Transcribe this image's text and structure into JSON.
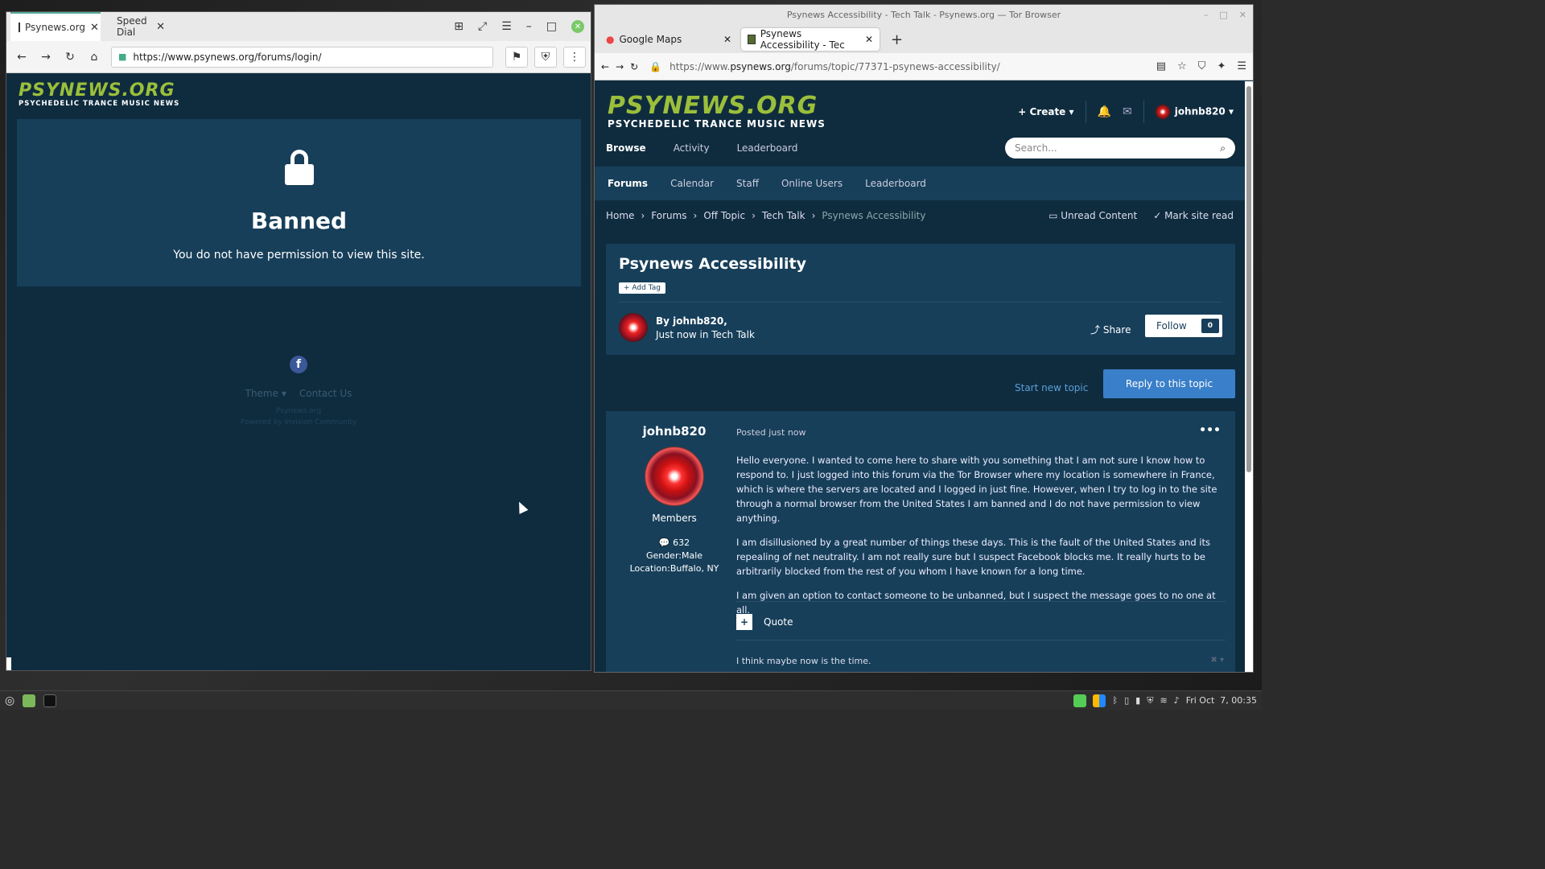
{
  "left_window": {
    "tabs": [
      {
        "label": "Psynews.org",
        "close": "✕"
      },
      {
        "label": "Speed Dial",
        "close": "✕"
      }
    ],
    "url": "https://www.psynews.org/forums/login/",
    "logo": {
      "line1": "PSYNEWS.ORG",
      "line2": "PSYCHEDELIC TRANCE MUSIC NEWS"
    },
    "ban_title": "Banned",
    "ban_message": "You do not have permission to view this site.",
    "footer": {
      "facebook": "f",
      "theme": "Theme ▾",
      "contact": "Contact Us",
      "site": "Psynews.org",
      "powered": "Powered by Invision Community"
    }
  },
  "right_window": {
    "title": "Psynews Accessibility - Tech Talk - Psynews.org — Tor Browser",
    "tabs": [
      {
        "label": "Google Maps"
      },
      {
        "label": "Psynews Accessibility - Tec"
      }
    ],
    "url_prefix": "https://www.",
    "url_domain": "psynews.org",
    "url_path": "/forums/topic/77371-psynews-accessibility/",
    "logo": {
      "line1": "PSYNEWS.ORG",
      "line2": "PSYCHEDELIC TRANCE MUSIC NEWS"
    },
    "create_label": "+ Create ▾",
    "username": "johnb820 ▾",
    "main_nav": [
      "Browse",
      "Activity",
      "Leaderboard"
    ],
    "search_placeholder": "Search...",
    "sub_nav": [
      "Forums",
      "Calendar",
      "Staff",
      "Online Users",
      "Leaderboard"
    ],
    "breadcrumb": [
      "Home",
      "Forums",
      "Off Topic",
      "Tech Talk",
      "Psynews Accessibility"
    ],
    "unread_content": "Unread Content",
    "mark_site_read": "Mark site read",
    "topic": {
      "title": "Psynews Accessibility",
      "add_tag": "+ Add Tag",
      "by_line": "By johnb820,",
      "posted_line": "Just now in Tech Talk",
      "share": "Share",
      "follow": "Follow",
      "follow_count": "0"
    },
    "start_new_topic": "Start new topic",
    "reply": "Reply to this topic",
    "post": {
      "author": "johnb820",
      "group": "Members",
      "posts": "632",
      "gender": "Gender:Male",
      "location": "Location:Buffalo, NY",
      "posted": "Posted just now",
      "paragraphs": [
        "Hello everyone. I wanted to come here to share with you something that I am not sure I know how to respond to. I just logged into this forum via the Tor Browser where my location is somewhere in France, which is where the servers are located and I logged in just fine. However, when I try to log in to the site through a normal browser from the United States I am banned and I do not have permission to view anything.",
        "I am disillusioned by a great number of things these days. This is the fault of the United States and its repealing of net neutrality. I am not really sure but I suspect Facebook blocks me. It really hurts to be arbitrarily blocked from the rest of you whom I have known for a long time.",
        "I am given an option to contact someone to be unbanned, but I suspect the message goes to no one at all."
      ],
      "quote": "Quote",
      "signature": "I think maybe now is the time."
    }
  },
  "taskbar": {
    "clock": "Fri Oct  7, 00:35"
  }
}
